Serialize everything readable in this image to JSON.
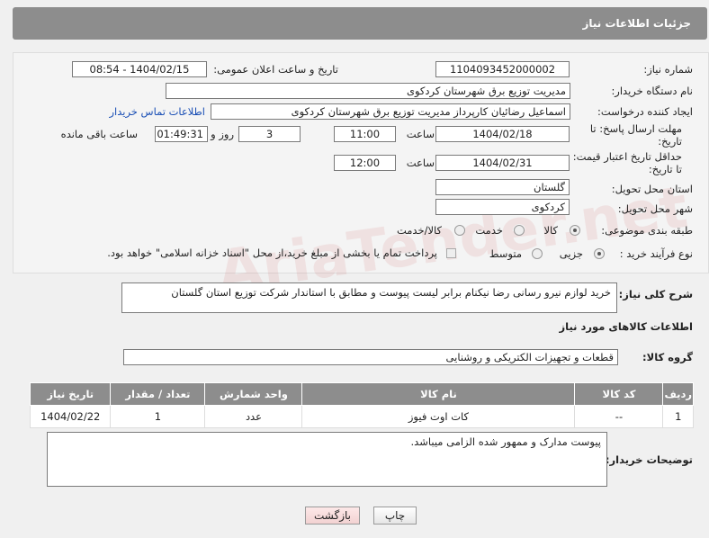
{
  "header": {
    "title": "جزئیات اطلاعات نیاز"
  },
  "watermark": "AriaTender.net",
  "form": {
    "need_number": {
      "label": "شماره نیاز:",
      "value": "1104093452000002"
    },
    "announce_datetime": {
      "label": "تاریخ و ساعت اعلان عمومی:",
      "value": "1404/02/15 - 08:54"
    },
    "buyer_org": {
      "label": "نام دستگاه خریدار:",
      "value": "مدیریت توزیع برق شهرستان کردکوی"
    },
    "requester": {
      "label": "ایجاد کننده درخواست:",
      "value": "اسماعیل رضائیان کارپرداز مدیریت توزیع برق شهرستان کردکوی",
      "contact_link": "اطلاعات تماس خریدار"
    },
    "reply_deadline": {
      "label": "مهلت ارسال پاسخ: تا تاریخ:",
      "date": "1404/02/18",
      "time_label": "ساعت",
      "time": "11:00",
      "days": "3",
      "days_label": "روز و",
      "remaining": "01:49:31",
      "remaining_label": "ساعت باقی مانده"
    },
    "price_validity": {
      "label": "حداقل تاریخ اعتبار قیمت: تا تاریخ:",
      "date": "1404/02/31",
      "time_label": "ساعت",
      "time": "12:00"
    },
    "province": {
      "label": "استان محل تحویل:",
      "value": "گلستان"
    },
    "city": {
      "label": "شهر محل تحویل:",
      "value": "کردکوی"
    },
    "category": {
      "label": "طبقه بندی موضوعی:",
      "options": [
        "کالا",
        "خدمت",
        "کالا/خدمت"
      ],
      "selected": "کالا"
    },
    "purchase_type": {
      "label": "نوع فرآیند خرید :",
      "options": [
        "جزیی",
        "متوسط"
      ],
      "selected": "جزیی",
      "note": "پرداخت تمام یا بخشی از مبلغ خرید،از محل \"اسناد خزانه اسلامی\" خواهد بود."
    }
  },
  "description": {
    "label": "شرح کلی نیاز:",
    "value": "خرید لوازم نیرو رسانی رضا نیکنام برابر لیست پیوست و مطابق با استاندار شرکت توزیع استان گلستان"
  },
  "goods_section": {
    "title": "اطلاعات کالاهای مورد نیاز",
    "group_label": "گروه کالا:",
    "group_value": "قطعات و تجهیزات الکتریکی و روشنایی"
  },
  "goods_table": {
    "columns": [
      "ردیف",
      "کد کالا",
      "نام کالا",
      "واحد شمارش",
      "تعداد / مقدار",
      "تاریخ نیاز"
    ],
    "rows": [
      [
        "1",
        "--",
        "کات اوت فیوز",
        "عدد",
        "1",
        "1404/02/22"
      ]
    ]
  },
  "buyer_notes": {
    "label": "توضیحات خریدار:",
    "value": "پیوست مدارک و ممهور شده الزامی میباشد."
  },
  "buttons": {
    "print": "چاپ",
    "back": "بازگشت"
  }
}
